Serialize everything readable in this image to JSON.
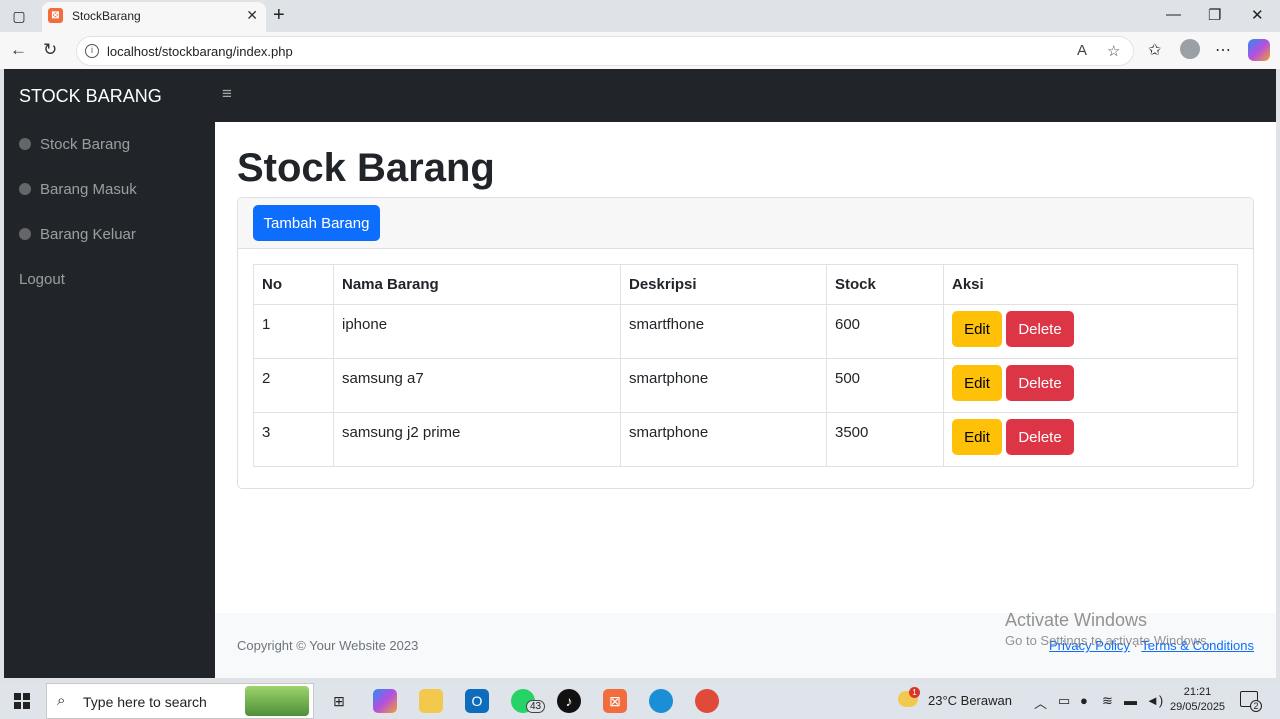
{
  "browser": {
    "tab_title": "StockBarang",
    "url": "localhost/stockbarang/index.php"
  },
  "sidebar": {
    "brand": "STOCK BARANG",
    "items": [
      {
        "label": "Stock Barang"
      },
      {
        "label": "Barang Masuk"
      },
      {
        "label": "Barang Keluar"
      },
      {
        "label": "Logout"
      }
    ]
  },
  "main": {
    "title": "Stock Barang",
    "add_button": "Tambah Barang",
    "table": {
      "headers": [
        "No",
        "Nama Barang",
        "Deskripsi",
        "Stock",
        "Aksi"
      ],
      "rows": [
        {
          "no": "1",
          "nama": "iphone",
          "deskripsi": "smartfhone",
          "stock": "600"
        },
        {
          "no": "2",
          "nama": "samsung a7",
          "deskripsi": "smartphone",
          "stock": "500"
        },
        {
          "no": "3",
          "nama": "samsung j2 prime",
          "deskripsi": "smartphone",
          "stock": "3500"
        }
      ],
      "edit_label": "Edit",
      "delete_label": "Delete"
    }
  },
  "footer": {
    "copyright": "Copyright © Your Website 2023",
    "privacy": "Privacy Policy",
    "separator": "·",
    "terms": "Terms & Conditions"
  },
  "watermark": {
    "line1": "Activate Windows",
    "line2": "Go to Settings to activate Windows."
  },
  "taskbar": {
    "search_placeholder": "Type here to search",
    "whatsapp_badge": "43",
    "weather": "23°C  Berawan",
    "weather_badge": "1",
    "time": "21:21",
    "date": "29/05/2025",
    "notification_count": "2"
  },
  "colors": {
    "sidebar_bg": "#212529",
    "primary": "#0d6efd",
    "warning": "#ffc107",
    "danger": "#dc3545"
  }
}
